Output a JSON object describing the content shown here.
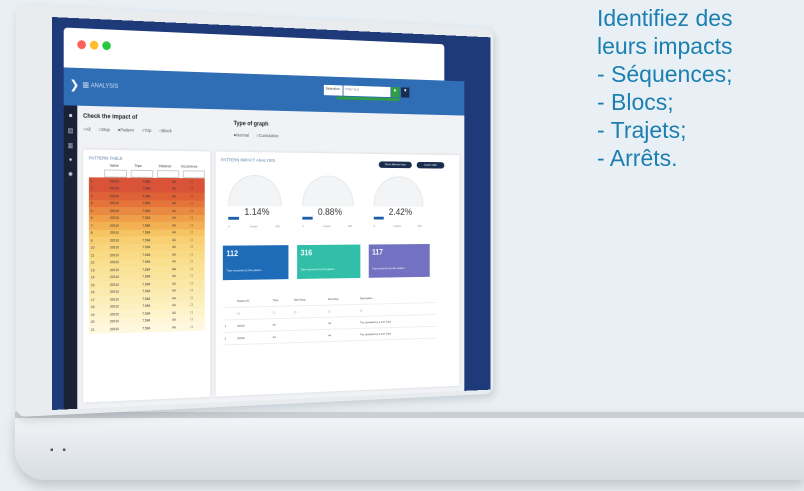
{
  "marketing": {
    "lines": [
      "Identifiez des",
      "leurs impacts",
      "- Séquences;",
      "- Blocs;",
      "- Trajets;",
      "- Arrêts."
    ]
  },
  "colors": {
    "brand": "#2f6db5",
    "sidebar": "#1b2238",
    "text_accent": "#1c7fb0"
  },
  "window": {
    "traffic_lights": [
      {
        "name": "close",
        "color": "#ff5f57"
      },
      {
        "name": "minimize",
        "color": "#febc2e"
      },
      {
        "name": "maximize",
        "color": "#28c840"
      }
    ]
  },
  "appbar": {
    "brand": "ANALYSIS",
    "menu_icon": "hamburger-icon",
    "selector": "Selection",
    "search_placeholder": "Filter text",
    "search_icon": "search-icon",
    "download_icon": "download-icon"
  },
  "sidebar": {
    "icons": [
      "home-icon",
      "list-icon",
      "chart-icon",
      "user-icon",
      "gear-icon"
    ]
  },
  "impact": {
    "heading": "Check the impact of",
    "options": [
      "All",
      "Stop",
      "Pattern",
      "Trip",
      "Block"
    ],
    "selected": "Pattern"
  },
  "graph_type": {
    "heading": "Type of graph",
    "options": [
      "Normal",
      "Cumulative"
    ],
    "selected": "Normal"
  },
  "pattern_table": {
    "title": "PATTERN TABLE",
    "columns": [
      "Name",
      "Trips",
      "Distance",
      "Occurrence"
    ],
    "rows": [
      {
        "id": "1",
        "name": "20010",
        "trips": "7.584",
        "dist": "44",
        "color": "#d95339"
      },
      {
        "id": "2",
        "name": "20010",
        "trips": "7.584",
        "dist": "44",
        "color": "#d95339"
      },
      {
        "id": "3",
        "name": "20010",
        "trips": "7.584",
        "dist": "44",
        "color": "#de6236"
      },
      {
        "id": "4",
        "name": "20010",
        "trips": "7.584",
        "dist": "44",
        "color": "#e4743a"
      },
      {
        "id": "5",
        "name": "20010",
        "trips": "7.584",
        "dist": "44",
        "color": "#ea8a42"
      },
      {
        "id": "6",
        "name": "20010",
        "trips": "7.584",
        "dist": "44",
        "color": "#ef9f48"
      },
      {
        "id": "7",
        "name": "20010",
        "trips": "7.584",
        "dist": "44",
        "color": "#f3b153"
      },
      {
        "id": "8",
        "name": "20010",
        "trips": "7.584",
        "dist": "44",
        "color": "#f6c463"
      },
      {
        "id": "9",
        "name": "20010",
        "trips": "7.584",
        "dist": "44",
        "color": "#f8cf72"
      },
      {
        "id": "10",
        "name": "20010",
        "trips": "7.584",
        "dist": "44",
        "color": "#f9d67e"
      },
      {
        "id": "11",
        "name": "20010",
        "trips": "7.584",
        "dist": "44",
        "color": "#f9db86"
      },
      {
        "id": "12",
        "name": "20010",
        "trips": "7.584",
        "dist": "44",
        "color": "#fadf8e"
      },
      {
        "id": "13",
        "name": "20010",
        "trips": "7.584",
        "dist": "44",
        "color": "#fae296"
      },
      {
        "id": "14",
        "name": "20010",
        "trips": "7.584",
        "dist": "44",
        "color": "#fbe59e"
      },
      {
        "id": "15",
        "name": "20010",
        "trips": "7.584",
        "dist": "44",
        "color": "#fbe8a6"
      },
      {
        "id": "16",
        "name": "20010",
        "trips": "7.584",
        "dist": "44",
        "color": "#fcebb0"
      },
      {
        "id": "17",
        "name": "20010",
        "trips": "7.584",
        "dist": "44",
        "color": "#fceeb8"
      },
      {
        "id": "18",
        "name": "20010",
        "trips": "7.584",
        "dist": "44",
        "color": "#fdf1c2"
      },
      {
        "id": "19",
        "name": "20010",
        "trips": "7.584",
        "dist": "44",
        "color": "#fdf4cc"
      },
      {
        "id": "20",
        "name": "20010",
        "trips": "7.584",
        "dist": "44",
        "color": "#fef6d6"
      },
      {
        "id": "21",
        "name": "20010",
        "trips": "7.584",
        "dist": "44",
        "color": "#fef8de"
      }
    ]
  },
  "impact_analysis": {
    "title": "PATTERN IMPACT ANALYSIS",
    "buttons": [
      "Show affected trips",
      "Export data"
    ],
    "gauges": [
      {
        "value": "1.14%",
        "scale_min": "0",
        "scale_label": "Impact",
        "scale_max": "100"
      },
      {
        "value": "0.88%",
        "scale_min": "0",
        "scale_label": "Impact",
        "scale_max": "100"
      },
      {
        "value": "2.42%",
        "scale_min": "0",
        "scale_label": "Impact",
        "scale_max": "100"
      }
    ],
    "kpis": [
      {
        "value": "112",
        "label": "Trips impacted by this pattern",
        "color": "#1e6bb8"
      },
      {
        "value": "316",
        "label": "Trips impacted by this pattern",
        "color": "#31bfa9"
      },
      {
        "value": "117",
        "label": "Trips impacted by this pattern",
        "color": "#7371c1"
      }
    ],
    "table": {
      "columns": [
        "Pattern ID",
        "Trips",
        "Start Stop",
        "End Stop",
        "Description"
      ],
      "rows": [
        {
          "id": "1",
          "pattern": "20010",
          "trips": "44",
          "end": "44",
          "desc": "Trip operated by a test Trips"
        },
        {
          "id": "2",
          "pattern": "20010",
          "trips": "44",
          "end": "44",
          "desc": "Trip operated by a test Trips"
        }
      ]
    }
  }
}
